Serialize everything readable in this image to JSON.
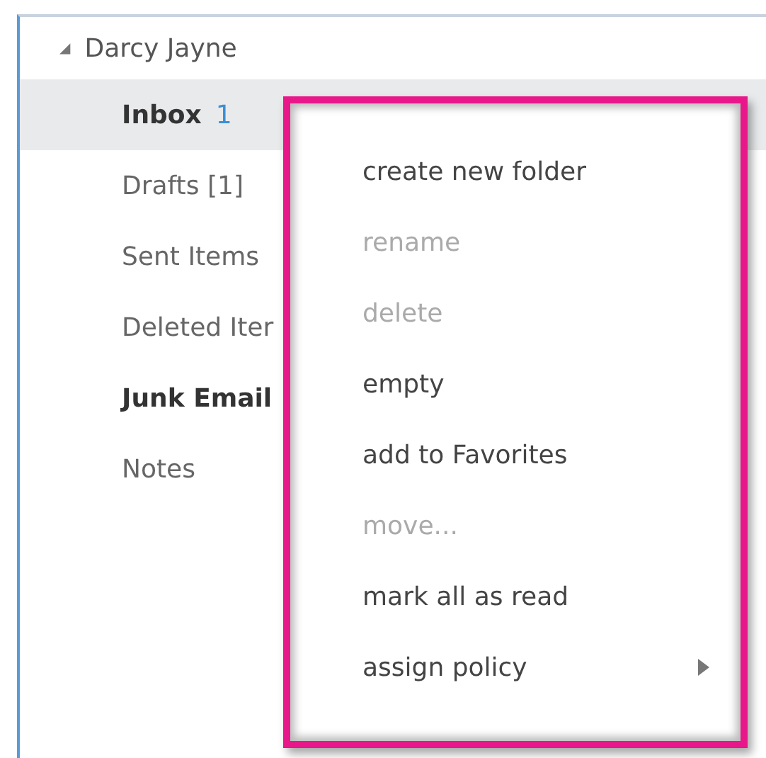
{
  "account": {
    "name": "Darcy Jayne",
    "expanded": true,
    "glyph": "◢"
  },
  "folders": [
    {
      "label": "Inbox",
      "count": "1",
      "selected": true,
      "bold": true
    },
    {
      "label": "Drafts [1]",
      "selected": false,
      "bold": false
    },
    {
      "label": "Sent Items",
      "selected": false,
      "bold": false
    },
    {
      "label": "Deleted Iter",
      "selected": false,
      "bold": false
    },
    {
      "label": "Junk Email",
      "selected": false,
      "bold": true
    },
    {
      "label": "Notes",
      "selected": false,
      "bold": false
    }
  ],
  "context_menu": {
    "items": [
      {
        "label": "create new folder",
        "disabled": false,
        "submenu": false
      },
      {
        "label": "rename",
        "disabled": true,
        "submenu": false
      },
      {
        "label": "delete",
        "disabled": true,
        "submenu": false
      },
      {
        "label": "empty",
        "disabled": false,
        "submenu": false
      },
      {
        "label": "add to Favorites",
        "disabled": false,
        "submenu": false
      },
      {
        "label": "move...",
        "disabled": true,
        "submenu": false
      },
      {
        "label": "mark all as read",
        "disabled": false,
        "submenu": false
      },
      {
        "label": "assign policy",
        "disabled": false,
        "submenu": true
      }
    ]
  }
}
